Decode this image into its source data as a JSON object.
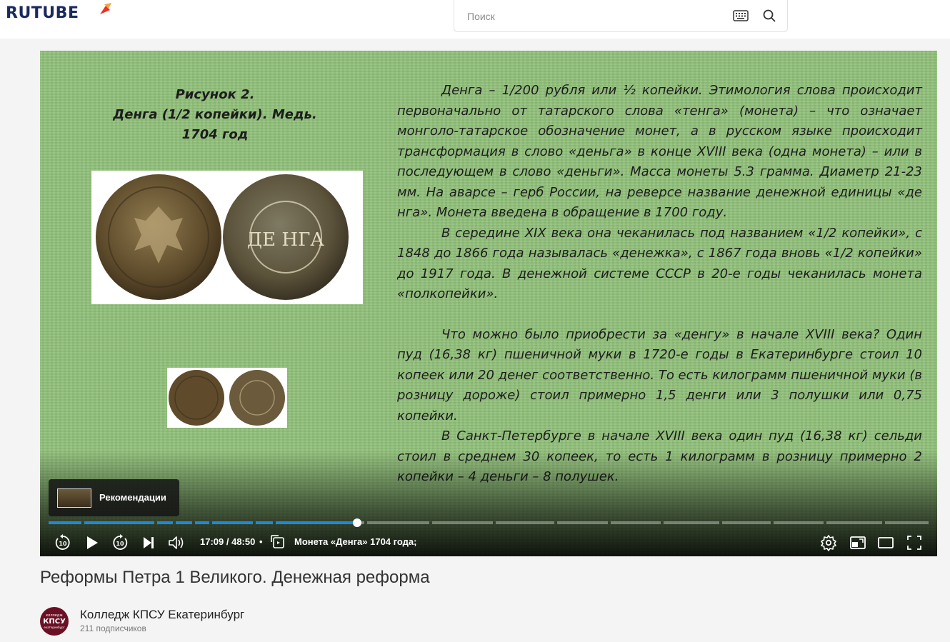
{
  "header": {
    "logo_text": "RUTUBE",
    "search": {
      "placeholder": "Поиск",
      "value": ""
    }
  },
  "player": {
    "slide": {
      "figure_caption": [
        "Рисунок 2.",
        "Денга (1/2 копейки). Медь.",
        "1704 год"
      ],
      "coin_big_text": "ДЕ НГА",
      "paragraphs": [
        "Денга – 1/200 рубля или ½ копейки. Этимология слова происходит первоначально от татарского слова «тенга» (монета) – что означает монголо-татарское обозначение монет, а в русском языке происходит трансформация в слово «деньга» в конце XVIII века (одна монета) – или в последующем в слово «деньги». Масса монеты 5.3 грамма. Диаметр 21-23 мм. На аварсе – герб России, на реверсе название денежной единицы «де нга». Монета введена в обращение в 1700 году.",
        "В середине XIX века она чеканилась под названием «1/2 копейки», с 1848 до 1866 года называлась «денежка», с 1867 года вновь «1/2 копейки» до 1917 года. В денежной системе СССР в 20-е годы чеканилась монета «полкопейки».",
        "Что можно было приобрести за «денгу» в начале XVIII века? Один пуд (16,38 кг) пшеничной муки в 1720-е годы в Екатеринбурге стоил 10 копеек или 20 денег соответственно. То есть килограмм пшеничной муки (в розницу дороже) стоил примерно 1,5 денги или 3 полушки или 0,75 копейки.",
        "В Санкт-Петербурге в начале XVIII века один пуд (16,38 кг) сельди стоил в среднем 30 копеек, то есть 1 килограмм в розницу примерно 2 копейки – 4 деньги – 8 полушек."
      ]
    },
    "recommendations_label": "Рекомендации",
    "time_display": "17:09 / 48:50",
    "separator": "•",
    "chapter_title": "Монета «Денга» 1704 года;",
    "progress_fraction": 0.351,
    "accent_color": "#1c8ad8"
  },
  "video": {
    "title": "Реформы Петра 1 Великого. Денежная реформа",
    "channel_name": "Колледж КПСУ Екатеринбург",
    "subscribers": "211 подписчиков",
    "avatar_text": [
      "колледж",
      "КПСУ",
      "екатеринбург"
    ]
  }
}
